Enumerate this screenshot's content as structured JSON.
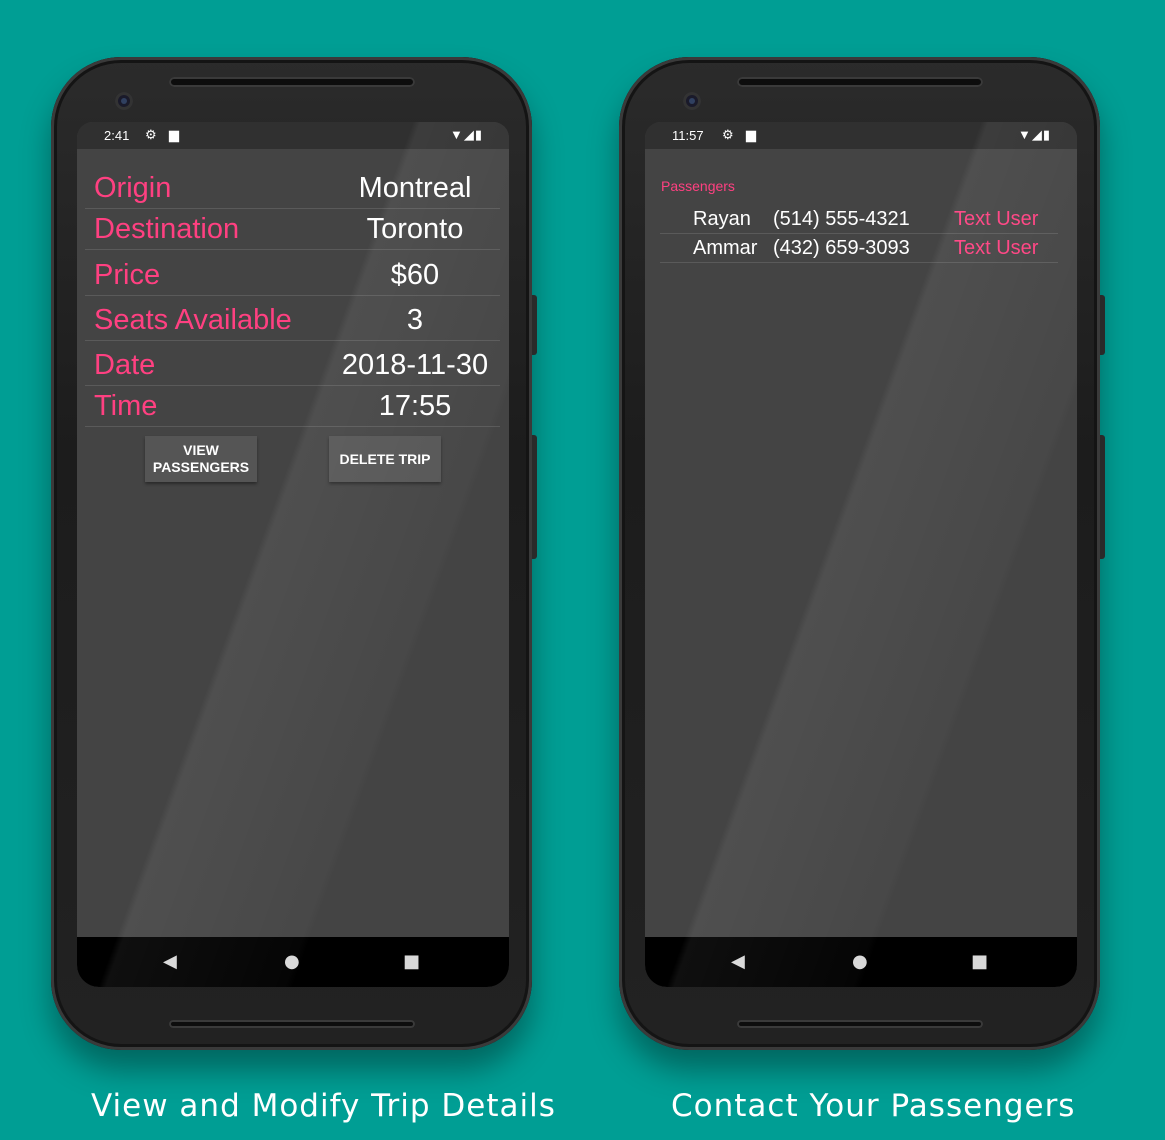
{
  "colors": {
    "background": "#009e94",
    "accent": "#ff4081",
    "screen": "#444444"
  },
  "left_phone": {
    "status": {
      "time": "2:41",
      "icons": [
        "gear-icon",
        "sd-card-icon",
        "wifi-icon",
        "signal-icon",
        "battery-icon"
      ]
    },
    "trip": {
      "rows": [
        {
          "label": "Origin",
          "value": "Montreal"
        },
        {
          "label": "Destination",
          "value": "Toronto"
        },
        {
          "label": "Price",
          "value": "$60"
        },
        {
          "label": "Seats Available",
          "value": "3"
        },
        {
          "label": "Date",
          "value": "2018-11-30"
        },
        {
          "label": "Time",
          "value": "17:55"
        }
      ]
    },
    "buttons": {
      "view_passengers_line1": "VIEW",
      "view_passengers_line2": "PASSENGERS",
      "delete_trip": "DELETE TRIP"
    },
    "caption": "View and Modify Trip Details"
  },
  "right_phone": {
    "status": {
      "time": "11:57",
      "icons": [
        "gear-icon",
        "sd-card-icon",
        "wifi-icon",
        "signal-icon",
        "battery-icon"
      ]
    },
    "passengers": {
      "title": "Passengers",
      "list": [
        {
          "name": "Rayan",
          "phone": "(514) 555-4321",
          "action": "Text User"
        },
        {
          "name": "Ammar",
          "phone": "(432) 659-3093",
          "action": "Text User"
        }
      ]
    },
    "caption": "Contact Your Passengers"
  }
}
